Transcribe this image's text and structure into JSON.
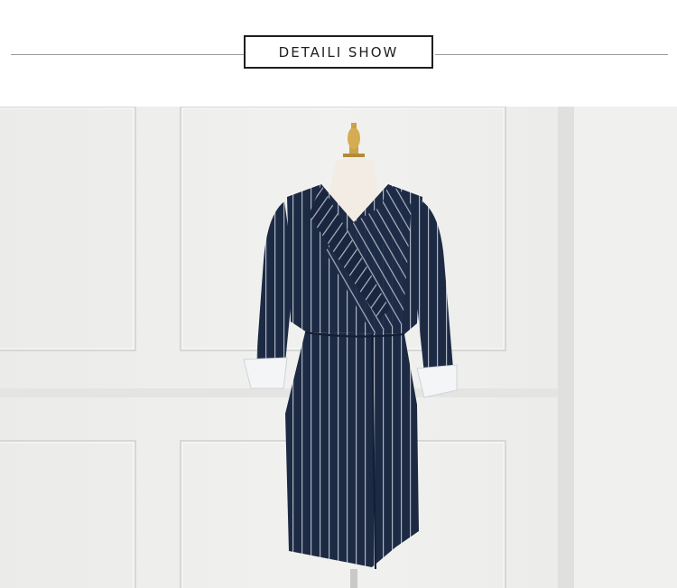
{
  "header": {
    "title": "DETAILI SHOW"
  },
  "photo": {
    "subject": "",
    "colors": {
      "wall": "#efefed",
      "wall_panel_shadow": "#d9d9d7",
      "dress": "#1d2a44",
      "stripe": "#c9ced8",
      "cuff": "#f4f5f7",
      "mannequin": "#f2ece4",
      "finial": "#c9a24a"
    }
  }
}
